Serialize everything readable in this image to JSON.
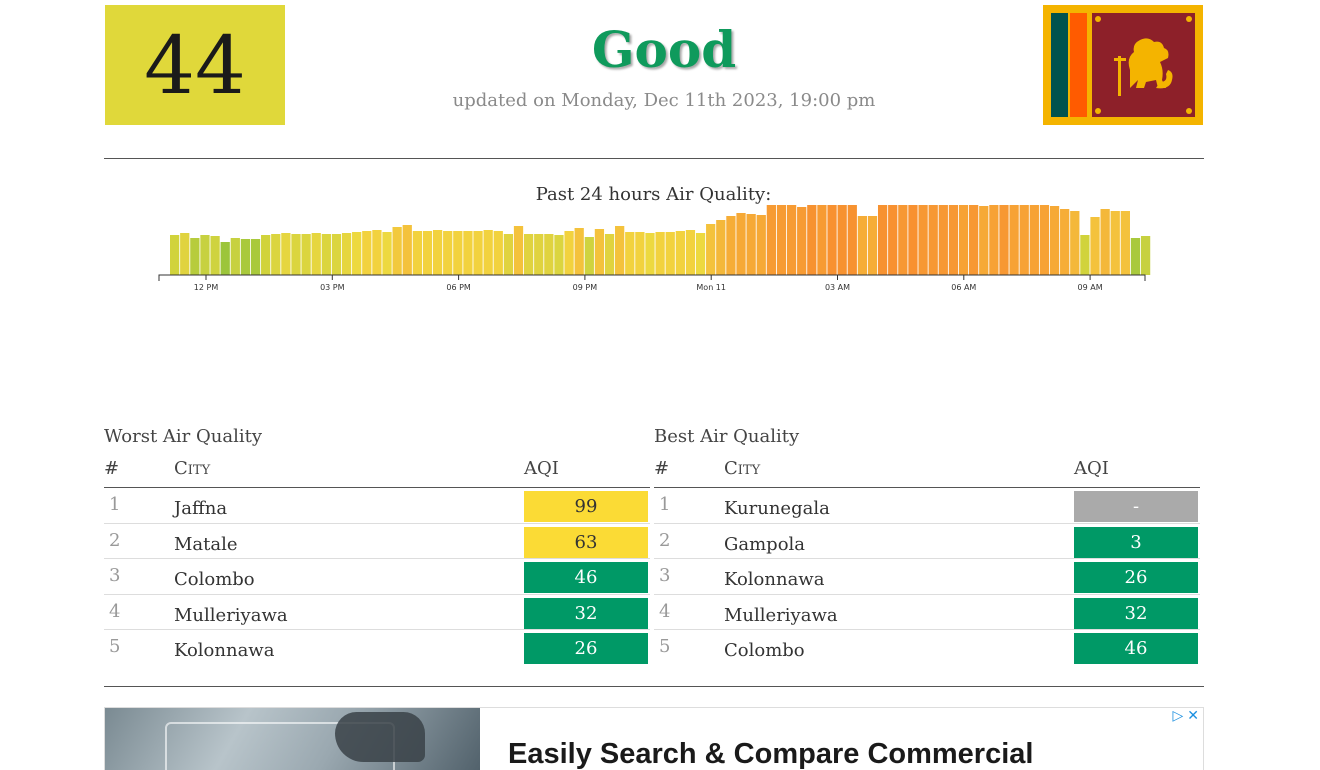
{
  "current": {
    "aqi": "44",
    "status": "Good",
    "updated": "updated on Monday, Dec 11th 2023, 19:00 pm",
    "aqi_color": "#e0d83a",
    "status_color": "#0f9a5c"
  },
  "flag_icon": "sri-lanka-flag-icon",
  "chart": {
    "title": "Past 24 hours Air Quality:"
  },
  "chart_data": {
    "type": "bar",
    "title": "Past 24 hours Air Quality:",
    "tick_labels": [
      "12 PM",
      "03 PM",
      "06 PM",
      "09 PM",
      "Mon 11",
      "03 AM",
      "06 AM",
      "09 AM"
    ],
    "values": [
      40,
      42,
      37,
      40,
      39,
      33,
      37,
      36,
      36,
      40,
      41,
      42,
      41,
      41,
      42,
      41,
      41,
      42,
      43,
      44,
      45,
      43,
      48,
      50,
      44,
      44,
      45,
      44,
      44,
      44,
      44,
      45,
      44,
      41,
      49,
      41,
      41,
      41,
      40,
      44,
      47,
      38,
      46,
      41,
      49,
      43,
      43,
      42,
      43,
      43,
      44,
      45,
      42,
      51,
      55,
      59,
      62,
      61,
      60,
      71,
      70,
      70,
      68,
      74,
      71,
      83,
      80,
      78,
      59,
      59,
      82,
      83,
      75,
      83,
      77,
      77,
      77,
      77,
      73,
      79,
      69,
      72,
      75,
      73,
      73,
      71,
      71,
      69,
      66,
      64,
      40,
      58,
      66,
      64,
      64,
      37,
      39
    ],
    "colors": [
      "#d1d33b",
      "#e0d33f",
      "#b7cc3d",
      "#c7d140",
      "#cfd33f",
      "#9cc53b",
      "#c7d140",
      "#a9c93c",
      "#a9c93c",
      "#d1d33b",
      "#dbd53f",
      "#e6d63f",
      "#dbd53f",
      "#dbd53f",
      "#e6d63f",
      "#dbd53f",
      "#dbd53f",
      "#e6d63f",
      "#edd93f",
      "#f2d23e",
      "#f2d23e",
      "#edd93f",
      "#f2c93d",
      "#f4c23c",
      "#f2d23e",
      "#f2d23e",
      "#f2d23e",
      "#f2d23e",
      "#f2d23e",
      "#f2d23e",
      "#f2d23e",
      "#f2d23e",
      "#f2d23e",
      "#e0d33f",
      "#f4c23c",
      "#e0d33f",
      "#e0d33f",
      "#e0d33f",
      "#dbd53f",
      "#f2d23e",
      "#f4c23c",
      "#cfd33f",
      "#f4c23c",
      "#e0d33f",
      "#f4c23c",
      "#f2d23e",
      "#f2d23e",
      "#edd93f",
      "#f2d23e",
      "#f2d23e",
      "#f2d23e",
      "#f2d23e",
      "#edd93f",
      "#f4c23c",
      "#f4b83a",
      "#f6ad37",
      "#f6a936",
      "#f6a936",
      "#f6a936",
      "#f79b33",
      "#f79b33",
      "#f79b33",
      "#f79b33",
      "#f79230",
      "#f79b33",
      "#f89130",
      "#f79230",
      "#f79230",
      "#f6ad37",
      "#f6ad37",
      "#f79230",
      "#f89130",
      "#f79833",
      "#f89130",
      "#f79833",
      "#f79833",
      "#f79833",
      "#f79833",
      "#f7a235",
      "#f79833",
      "#f6a936",
      "#f7a235",
      "#f79833",
      "#f7a235",
      "#f7a235",
      "#f7a235",
      "#f7a235",
      "#f6a936",
      "#f6ad37",
      "#f4b83a",
      "#d1d33b",
      "#f4c23c",
      "#f4b83a",
      "#f4c23c",
      "#f4c23c",
      "#a9c93c",
      "#c7d140"
    ],
    "ylim": [
      0,
      100
    ],
    "grid": false,
    "legend": "none"
  },
  "worst": {
    "title": "Worst Air Quality",
    "headers": {
      "num": "#",
      "city": "City",
      "aqi": "AQI"
    },
    "rows": [
      {
        "num": "1",
        "city": "Jaffna",
        "aqi": "99",
        "bg": "#fbdb35",
        "fg": "#333333"
      },
      {
        "num": "2",
        "city": "Matale",
        "aqi": "63",
        "bg": "#fbdb35",
        "fg": "#333333"
      },
      {
        "num": "3",
        "city": "Colombo",
        "aqi": "46",
        "bg": "#009966",
        "fg": "#ffffff"
      },
      {
        "num": "4",
        "city": "Mulleriyawa",
        "aqi": "32",
        "bg": "#009966",
        "fg": "#ffffff"
      },
      {
        "num": "5",
        "city": "Kolonnawa",
        "aqi": "26",
        "bg": "#009966",
        "fg": "#ffffff"
      }
    ]
  },
  "best": {
    "title": "Best Air Quality",
    "headers": {
      "num": "#",
      "city": "City",
      "aqi": "AQI"
    },
    "rows": [
      {
        "num": "1",
        "city": "Kurunegala",
        "aqi": "-",
        "bg": "#aaaaaa",
        "fg": "#ffffff"
      },
      {
        "num": "2",
        "city": "Gampola",
        "aqi": "3",
        "bg": "#009966",
        "fg": "#ffffff"
      },
      {
        "num": "3",
        "city": "Kolonnawa",
        "aqi": "26",
        "bg": "#009966",
        "fg": "#ffffff"
      },
      {
        "num": "4",
        "city": "Mulleriyawa",
        "aqi": "32",
        "bg": "#009966",
        "fg": "#ffffff"
      },
      {
        "num": "5",
        "city": "Colombo",
        "aqi": "46",
        "bg": "#009966",
        "fg": "#ffffff"
      }
    ]
  },
  "ad": {
    "headline": "Easily Search & Compare Commercial",
    "adchoices_icon": "adchoices-icon",
    "close_icon": "close-icon"
  }
}
